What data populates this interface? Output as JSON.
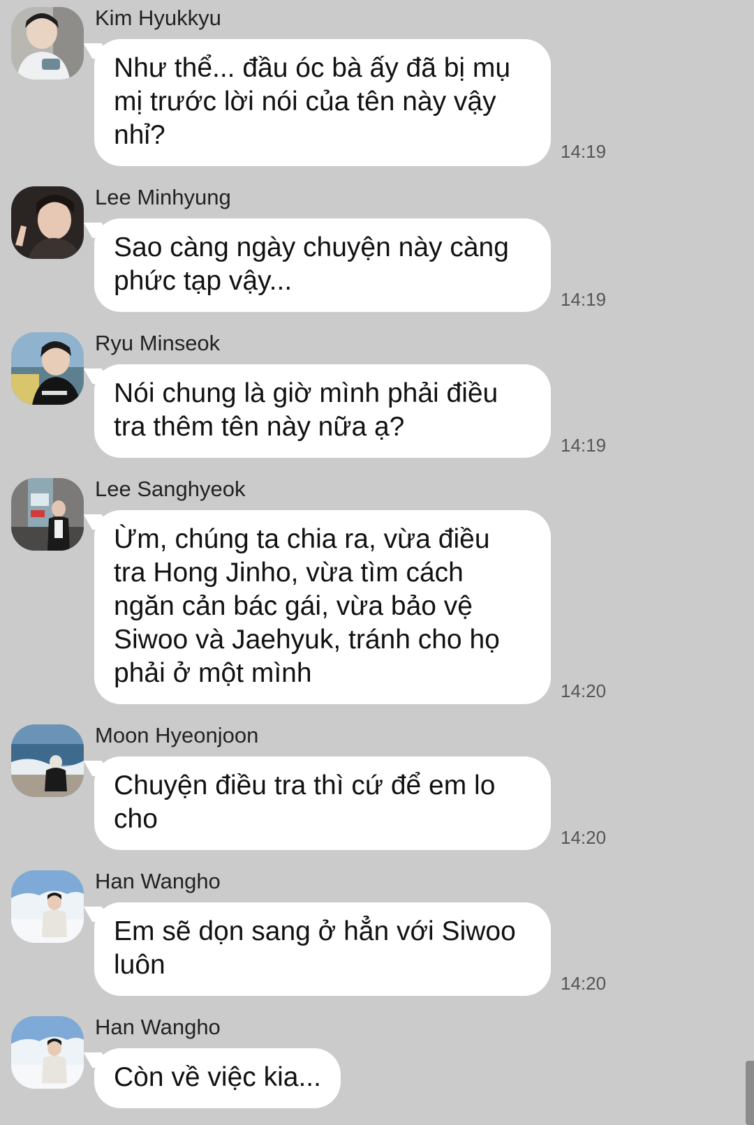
{
  "messages": [
    {
      "sender": "Kim Hyukkyu",
      "lines": [
        "Như thể... đầu óc bà ấy đã bị mụ",
        "mị trước lời nói của tên này vậy",
        "nhỉ?"
      ],
      "time": "14:19"
    },
    {
      "sender": "Lee Minhyung",
      "lines": [
        "Sao càng ngày chuyện này càng",
        "phức tạp vậy..."
      ],
      "time": "14:19"
    },
    {
      "sender": "Ryu Minseok",
      "lines": [
        "Nói chung là giờ mình phải điều",
        "tra thêm tên này nữa ạ?"
      ],
      "time": "14:19"
    },
    {
      "sender": "Lee Sanghyeok",
      "lines": [
        "Ừm, chúng ta chia ra, vừa điều",
        "tra Hong Jinho, vừa tìm cách",
        "ngăn cản bác gái, vừa bảo vệ",
        "Siwoo và Jaehyuk, tránh cho họ",
        "phải ở một mình"
      ],
      "time": "14:20"
    },
    {
      "sender": "Moon Hyeonjoon",
      "lines": [
        "Chuyện điều tra thì cứ để em lo",
        "cho"
      ],
      "time": "14:20"
    },
    {
      "sender": "Han Wangho",
      "lines": [
        "Em sẽ dọn sang ở hẳn với Siwoo",
        "luôn"
      ],
      "time": "14:20"
    },
    {
      "sender": "Han Wangho",
      "lines": [
        "Còn về việc kia..."
      ],
      "time": ""
    }
  ],
  "colors": {
    "background": "#cbcbcb",
    "bubble": "#ffffff",
    "name_text": "#222222",
    "time_text": "#555555"
  }
}
